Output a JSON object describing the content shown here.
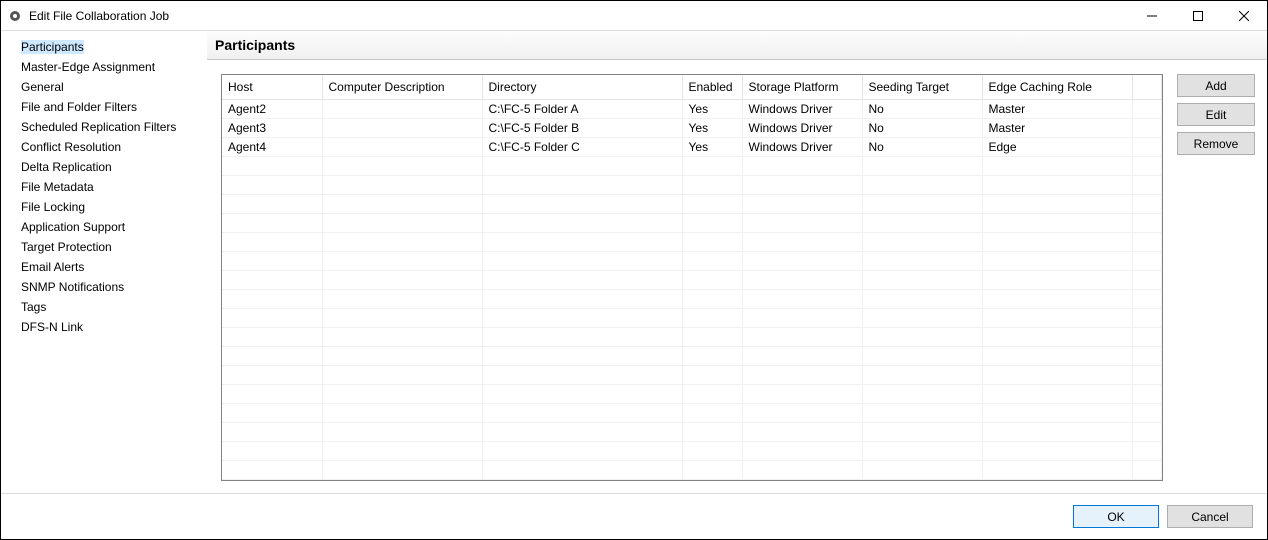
{
  "window": {
    "title": "Edit File Collaboration Job"
  },
  "sidebar": {
    "items": [
      {
        "label": "Participants",
        "selected": true
      },
      {
        "label": "Master-Edge Assignment"
      },
      {
        "label": "General"
      },
      {
        "label": "File and Folder Filters"
      },
      {
        "label": "Scheduled Replication Filters"
      },
      {
        "label": "Conflict Resolution"
      },
      {
        "label": "Delta Replication"
      },
      {
        "label": "File Metadata"
      },
      {
        "label": "File Locking"
      },
      {
        "label": "Application Support"
      },
      {
        "label": "Target Protection"
      },
      {
        "label": "Email Alerts"
      },
      {
        "label": "SNMP Notifications"
      },
      {
        "label": "Tags"
      },
      {
        "label": "DFS-N Link"
      }
    ]
  },
  "main": {
    "title": "Participants",
    "columns": [
      "Host",
      "Computer Description",
      "Directory",
      "Enabled",
      "Storage Platform",
      "Seeding Target",
      "Edge Caching Role"
    ],
    "rows": [
      {
        "host": "Agent2",
        "desc": "",
        "dir": "C:\\FC-5 Folder A",
        "enabled": "Yes",
        "storage": "Windows Driver",
        "seeding": "No",
        "role": "Master"
      },
      {
        "host": "Agent3",
        "desc": "",
        "dir": "C:\\FC-5 Folder B",
        "enabled": "Yes",
        "storage": "Windows Driver",
        "seeding": "No",
        "role": "Master"
      },
      {
        "host": "Agent4",
        "desc": "",
        "dir": "C:\\FC-5 Folder C",
        "enabled": "Yes",
        "storage": "Windows Driver",
        "seeding": "No",
        "role": "Edge"
      }
    ],
    "buttons": {
      "add": "Add",
      "edit": "Edit",
      "remove": "Remove"
    }
  },
  "footer": {
    "ok": "OK",
    "cancel": "Cancel"
  }
}
